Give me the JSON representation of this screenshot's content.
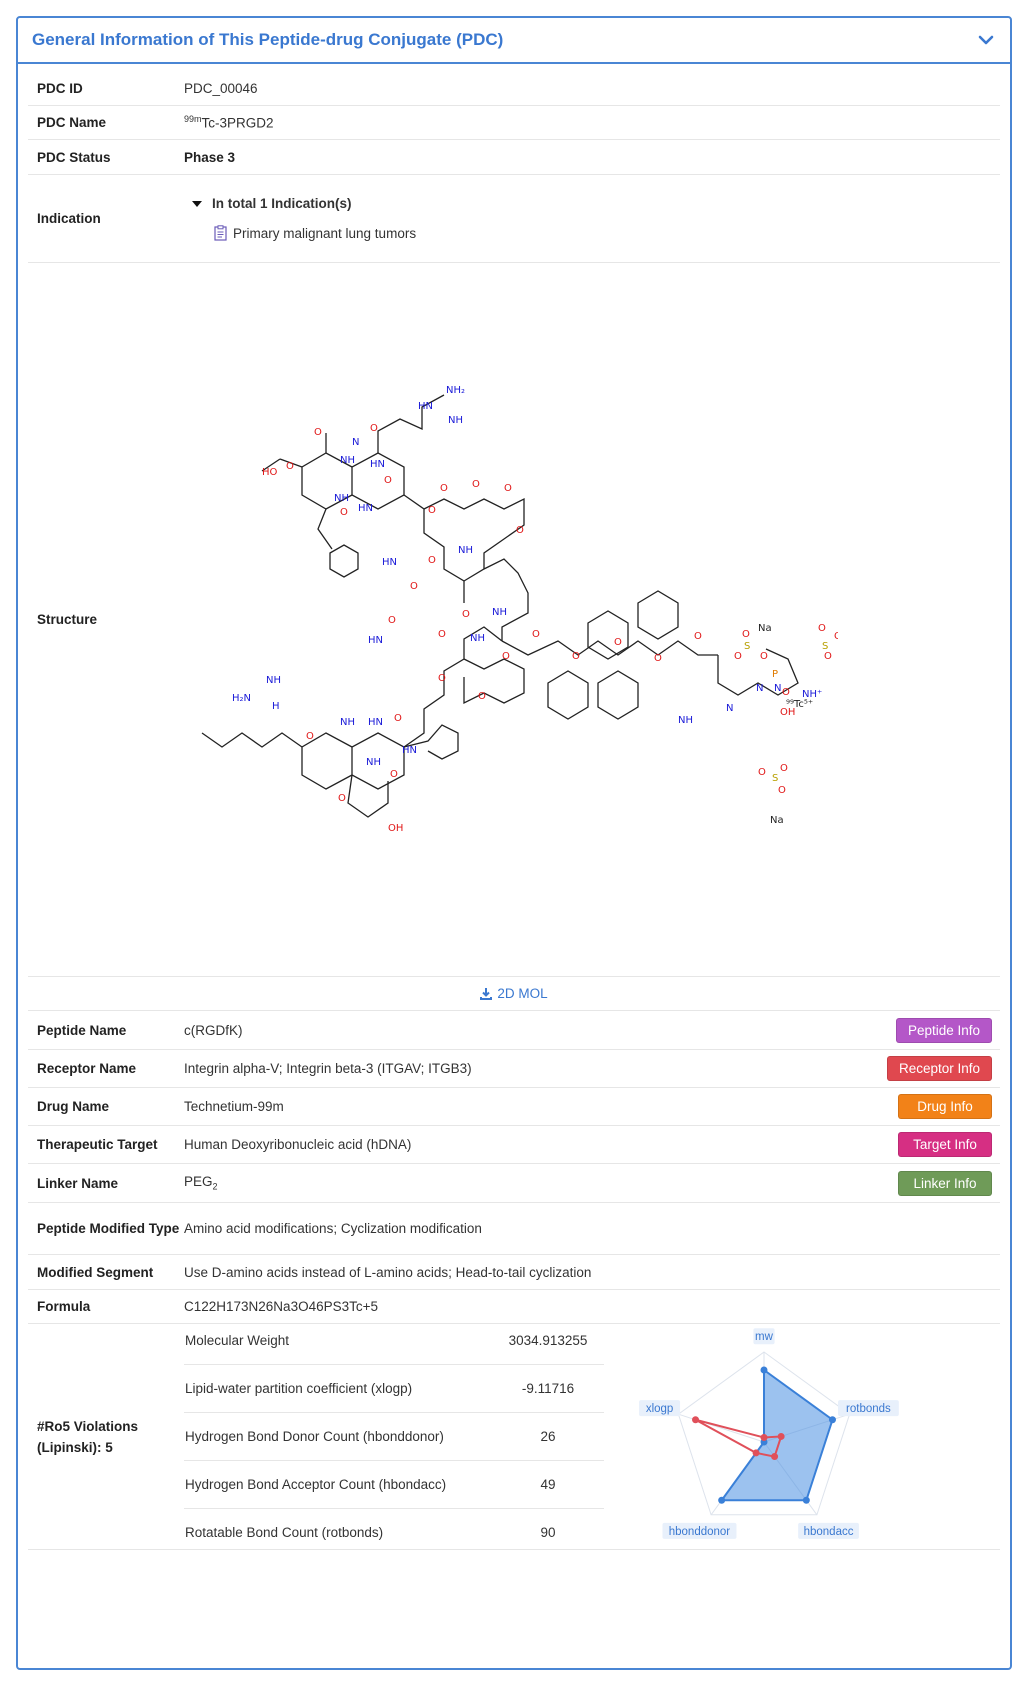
{
  "panel": {
    "title": "General Information of This Peptide-drug Conjugate (PDC)"
  },
  "rows": {
    "pdc_id": {
      "label": "PDC ID",
      "value": "PDC_00046"
    },
    "pdc_name": {
      "label": "PDC Name",
      "sup": "99m",
      "value": "Tc-3PRGD2"
    },
    "pdc_status": {
      "label": "PDC Status",
      "value": "Phase 3"
    },
    "indication": {
      "label": "Indication",
      "summary": "In total 1 Indication(s)",
      "items": [
        "Primary malignant lung tumors"
      ]
    },
    "structure": {
      "label": "Structure",
      "download": "2D MOL"
    },
    "peptide_name": {
      "label": "Peptide Name",
      "value": "c(RGDfK)",
      "button": "Peptide Info"
    },
    "receptor_name": {
      "label": "Receptor Name",
      "value": "Integrin alpha-V; Integrin beta-3 (ITGAV; ITGB3)",
      "button": "Receptor Info"
    },
    "drug_name": {
      "label": "Drug Name",
      "value": "Technetium-99m",
      "button": "Drug Info"
    },
    "therapeutic_target": {
      "label": "Therapeutic Target",
      "value": "Human Deoxyribonucleic acid (hDNA)",
      "button": "Target Info"
    },
    "linker_name": {
      "label": "Linker Name",
      "value": "PEG",
      "sub": "2",
      "button": "Linker Info"
    },
    "peptide_modified_type": {
      "label": "Peptide Modified Type",
      "value": "Amino acid modifications; Cyclization modification"
    },
    "modified_segment": {
      "label": "Modified Segment",
      "value": "Use D-amino acids instead of L-amino acids; Head-to-tail cyclization"
    },
    "formula": {
      "label": "Formula",
      "value": "C122H173N26Na3O46PS3Tc+5"
    },
    "ro5": {
      "label": "#Ro5 Violations (Lipinski): 5",
      "properties": [
        {
          "name": "Molecular Weight",
          "value": "3034.913255"
        },
        {
          "name": "Lipid-water partition coefficient (xlogp)",
          "value": "-9.11716"
        },
        {
          "name": "Hydrogen Bond Donor Count (hbonddonor)",
          "value": "26"
        },
        {
          "name": "Hydrogen Bond Acceptor Count (hbondacc)",
          "value": "49"
        },
        {
          "name": "Rotatable Bond Count (rotbonds)",
          "value": "90"
        }
      ]
    }
  },
  "colors": {
    "accent": "#3a78d0",
    "peptide_btn": "#b457c8",
    "receptor_btn": "#e0484f",
    "drug_btn": "#f28218",
    "target_btn": "#d62f83",
    "linker_btn": "#6f9b58"
  },
  "chart_data": {
    "type": "radar",
    "axes": [
      "mw",
      "rotbonds",
      "hbondacc",
      "hbonddonor",
      "xlogp"
    ],
    "series": [
      {
        "values": [
          0.8,
          0.8,
          0.8,
          0.8,
          0.0
        ]
      },
      {
        "values": [
          0.05,
          0.2,
          0.2,
          0.15,
          0.8
        ]
      }
    ]
  }
}
